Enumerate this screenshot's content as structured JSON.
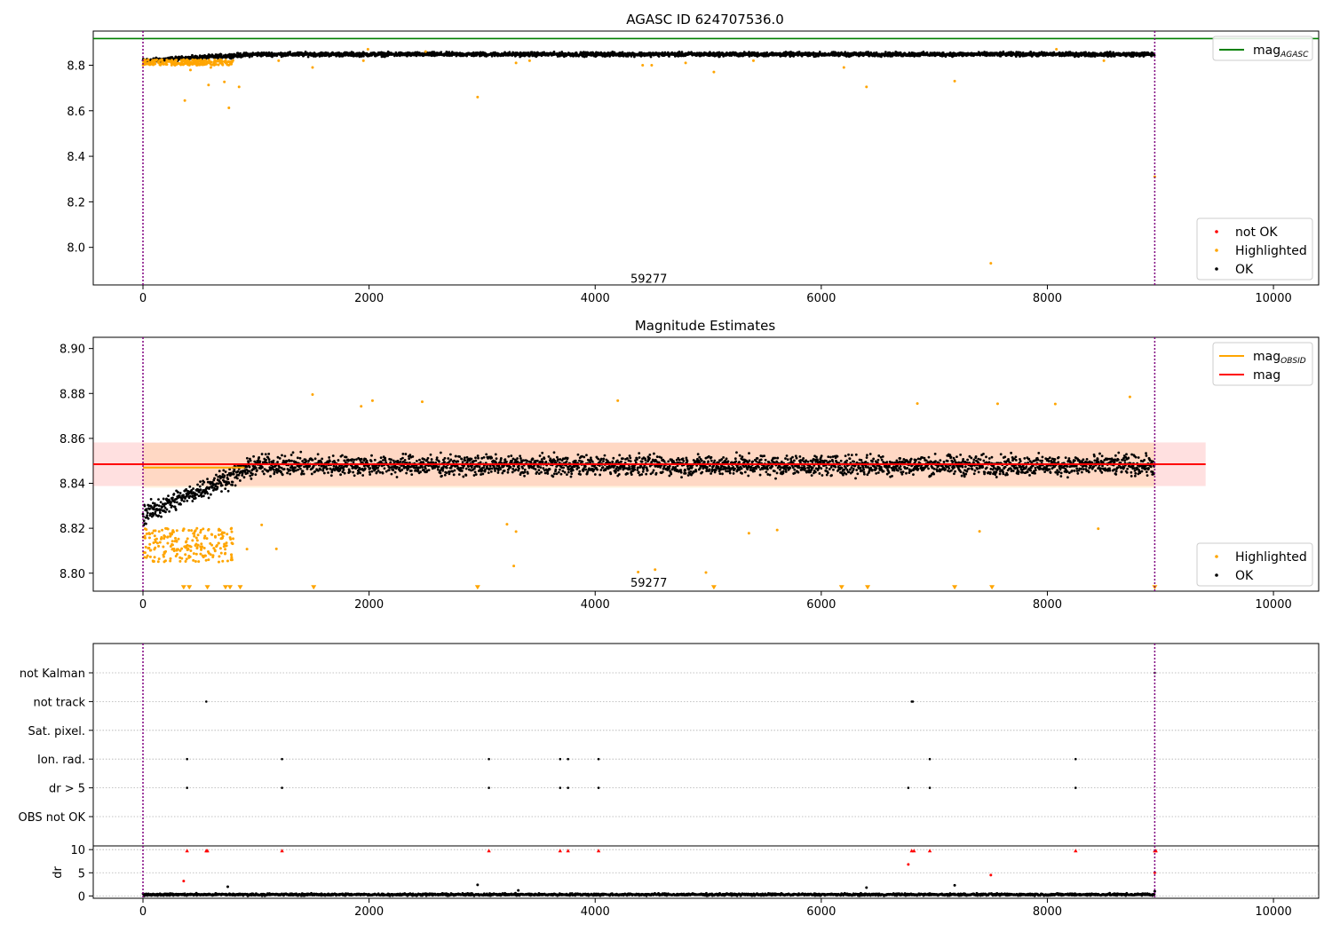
{
  "chart_data": [
    {
      "type": "scatter",
      "title": "AGASC ID 624707536.0",
      "xlabel": "",
      "ylabel": "",
      "xlim": [
        -440,
        10400
      ],
      "ylim": [
        7.835,
        8.95
      ],
      "xticks": [
        0,
        2000,
        4000,
        6000,
        8000,
        10000
      ],
      "yticks": [
        8.0,
        8.2,
        8.4,
        8.6,
        8.8
      ],
      "ytick_labels": [
        "8.0",
        "8.2",
        "8.4",
        "8.6",
        "8.8"
      ],
      "vlines": [
        0,
        8950
      ],
      "annotations": [
        {
          "text": "59277",
          "x": 4475,
          "y": 7.86
        }
      ],
      "hlines": [
        {
          "name": "mag",
          "subscript": "AGASC",
          "y": 8.917,
          "color": "#008000"
        }
      ],
      "legend_lines": {
        "placement": "top-right",
        "entries": [
          {
            "name": "mag",
            "subscript": "AGASC",
            "color": "#008000"
          }
        ]
      },
      "legend_points": {
        "placement": "bottom-right",
        "entries": [
          {
            "name": "not OK",
            "color": "#ff0000"
          },
          {
            "name": "Highlighted",
            "color": "#ffa500"
          },
          {
            "name": "OK",
            "color": "#000000"
          }
        ]
      },
      "series": [
        {
          "name": "OK",
          "color": "#000000",
          "band": {
            "x": [
              0,
              8950
            ],
            "base": 8.82,
            "plateau": 8.848,
            "rise_end": 1000,
            "jitter": 0.013
          }
        },
        {
          "name": "Highlighted",
          "color": "#ffa500",
          "early_band": {
            "x": [
              0,
              800
            ],
            "y": [
              8.8,
              8.825
            ]
          },
          "x": [
            370,
            420,
            580,
            720,
            760,
            850,
            1500,
            2960,
            7500,
            6400,
            7180,
            8950,
            600,
            1200,
            1950,
            2500,
            3300,
            4500,
            4800,
            5050,
            5400,
            6200,
            8080,
            8500,
            4420,
            1990,
            3420
          ],
          "y": [
            8.645,
            8.779,
            8.713,
            8.727,
            8.613,
            8.705,
            8.79,
            8.66,
            7.93,
            8.705,
            8.73,
            8.31,
            8.79,
            8.82,
            8.82,
            8.86,
            8.81,
            8.8,
            8.81,
            8.77,
            8.82,
            8.79,
            8.87,
            8.82,
            8.8,
            8.87,
            8.82
          ]
        }
      ]
    },
    {
      "type": "scatter",
      "title": "Magnitude Estimates",
      "xlabel": "",
      "ylabel": "",
      "xlim": [
        -440,
        10400
      ],
      "ylim": [
        8.792,
        8.905
      ],
      "xticks": [
        0,
        2000,
        4000,
        6000,
        8000,
        10000
      ],
      "yticks": [
        8.8,
        8.82,
        8.84,
        8.86,
        8.88,
        8.9
      ],
      "ytick_labels": [
        "8.80",
        "8.82",
        "8.84",
        "8.86",
        "8.88",
        "8.90"
      ],
      "vlines": [
        0,
        8950
      ],
      "annotations": [
        {
          "text": "59277",
          "x": 4475,
          "y": 8.7955
        }
      ],
      "hlines": [
        {
          "name": "mag",
          "subscript": "OBSID",
          "color": "#ffa500",
          "segments": [
            [
              0,
              900,
              8.847
            ],
            [
              900,
              8950,
              8.8485
            ]
          ]
        },
        {
          "name": "mag",
          "color": "#ff0000",
          "segments": [
            [
              -440,
              9400,
              8.8485
            ]
          ]
        }
      ],
      "bands": [
        {
          "color": "#ff0000",
          "x": [
            -440,
            9400
          ],
          "y": [
            8.8388,
            8.8582
          ]
        },
        {
          "color": "#ffa500",
          "x": [
            0,
            8950
          ],
          "y": [
            8.838,
            8.858
          ]
        }
      ],
      "legend_lines": {
        "placement": "top-right",
        "entries": [
          {
            "name": "mag",
            "subscript": "OBSID",
            "color": "#ffa500"
          },
          {
            "name": "mag",
            "color": "#ff0000"
          }
        ]
      },
      "legend_points": {
        "placement": "bottom-right",
        "entries": [
          {
            "name": "Highlighted",
            "color": "#ffa500"
          },
          {
            "name": "OK",
            "color": "#000000"
          }
        ]
      },
      "series": [
        {
          "name": "OK",
          "color": "#000000",
          "band": {
            "x": [
              0,
              8950
            ],
            "base": 8.826,
            "plateau": 8.848,
            "rise_end": 1000,
            "jitter": 0.0065
          }
        },
        {
          "name": "Highlighted",
          "color": "#ffa500",
          "early_band": {
            "x": [
              0,
              800
            ],
            "y": [
              8.805,
              8.82
            ]
          },
          "x": [
            1500,
            2030,
            1930,
            2470,
            4200,
            6850,
            7560,
            8070,
            8730,
            3220,
            3300,
            3280,
            4380,
            4530,
            4980,
            5360,
            5610,
            7400,
            8450,
            920,
            1180,
            1050
          ],
          "y": [
            8.8795,
            8.8768,
            8.8743,
            8.8763,
            8.8768,
            8.8755,
            8.8754,
            8.8753,
            8.8785,
            8.8218,
            8.8185,
            8.8032,
            8.8005,
            8.8016,
            8.8003,
            8.8178,
            8.8192,
            8.8186,
            8.8198,
            8.8107,
            8.8108,
            8.8215
          ]
        },
        {
          "name": "Highlighted-clipped",
          "color": "#ffa500",
          "marker": "triangle-down",
          "x": [
            360,
            410,
            570,
            730,
            770,
            860,
            1510,
            2960,
            5050,
            6180,
            6410,
            7180,
            7510,
            8950
          ],
          "y": [
            8.7935,
            8.7935,
            8.7935,
            8.7935,
            8.7935,
            8.7935,
            8.7935,
            8.7935,
            8.7935,
            8.7935,
            8.7935,
            8.7935,
            8.7935,
            8.7935
          ]
        }
      ]
    },
    {
      "type": "scatter",
      "title": "",
      "xlabel": "",
      "ylabel": "",
      "xlim": [
        -440,
        10400
      ],
      "vlines": [
        0,
        8950
      ],
      "categories": [
        "not Kalman",
        "not track",
        "Sat. pixel.",
        "Ion. rad.",
        "dr > 5",
        "OBS not OK"
      ],
      "flags": [
        {
          "category": "not track",
          "x": [
            560,
            6800,
            6810
          ]
        },
        {
          "category": "Ion. rad.",
          "x": [
            390,
            1230,
            3060,
            3690,
            3760,
            4030,
            6960,
            8250
          ]
        },
        {
          "category": "dr > 5",
          "x": [
            390,
            1230,
            3060,
            3690,
            3760,
            4030,
            6770,
            6960,
            8250
          ]
        },
        {
          "category": "not Kalman",
          "x": [
            8950
          ]
        }
      ]
    },
    {
      "type": "scatter",
      "title": "",
      "xlabel": "",
      "ylabel": "dr",
      "xlim": [
        -440,
        10400
      ],
      "ylim": [
        -0.5,
        10.8
      ],
      "yticks": [
        0,
        5,
        10
      ],
      "ytick_labels": [
        "0",
        "5",
        "10"
      ],
      "vlines": [
        0,
        8950
      ],
      "series": [
        {
          "name": "OK",
          "color": "#000000",
          "band": {
            "x": [
              0,
              8950
            ],
            "base": 0.3,
            "plateau": 0.3,
            "rise_end": 0,
            "jitter": 0.35
          }
        },
        {
          "name": "not OK",
          "color": "#ff0000",
          "marker": "triangle-up",
          "x": [
            390,
            560,
            570,
            1230,
            3060,
            3690,
            3760,
            4030,
            6800,
            6820,
            6960,
            8250,
            8950,
            8960
          ],
          "y": [
            9.8,
            9.8,
            9.8,
            9.8,
            9.8,
            9.8,
            9.8,
            9.8,
            9.8,
            9.8,
            9.8,
            9.8,
            9.8,
            9.8
          ]
        },
        {
          "name": "not OK-dots",
          "color": "#ff0000",
          "x": [
            360,
            6770,
            7500,
            8950
          ],
          "y": [
            3.2,
            6.8,
            4.5,
            5.0
          ]
        },
        {
          "name": "OK-outliers",
          "color": "#000000",
          "x": [
            750,
            2960,
            3320,
            6400,
            7180,
            8950
          ],
          "y": [
            2.0,
            2.4,
            1.2,
            1.8,
            2.3,
            1.0
          ]
        }
      ]
    }
  ]
}
